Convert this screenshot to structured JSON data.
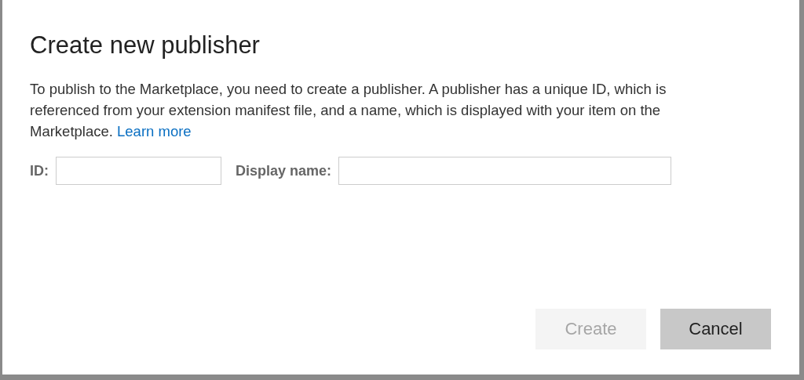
{
  "dialog": {
    "title": "Create new publisher",
    "description": "To publish to the Marketplace, you need to create a publisher. A publisher has a unique ID, which is referenced from your extension manifest file, and a name, which is displayed with your item on the Marketplace.",
    "link": "Learn more",
    "fields": [
      {
        "label": "ID:",
        "kind": "short"
      },
      {
        "label": "Display name:",
        "kind": "long"
      }
    ],
    "buttons": [
      {
        "label": "Create",
        "kind": "primary",
        "disabled": true
      },
      {
        "label": "Cancel",
        "kind": "secondary",
        "disabled": false
      }
    ]
  }
}
